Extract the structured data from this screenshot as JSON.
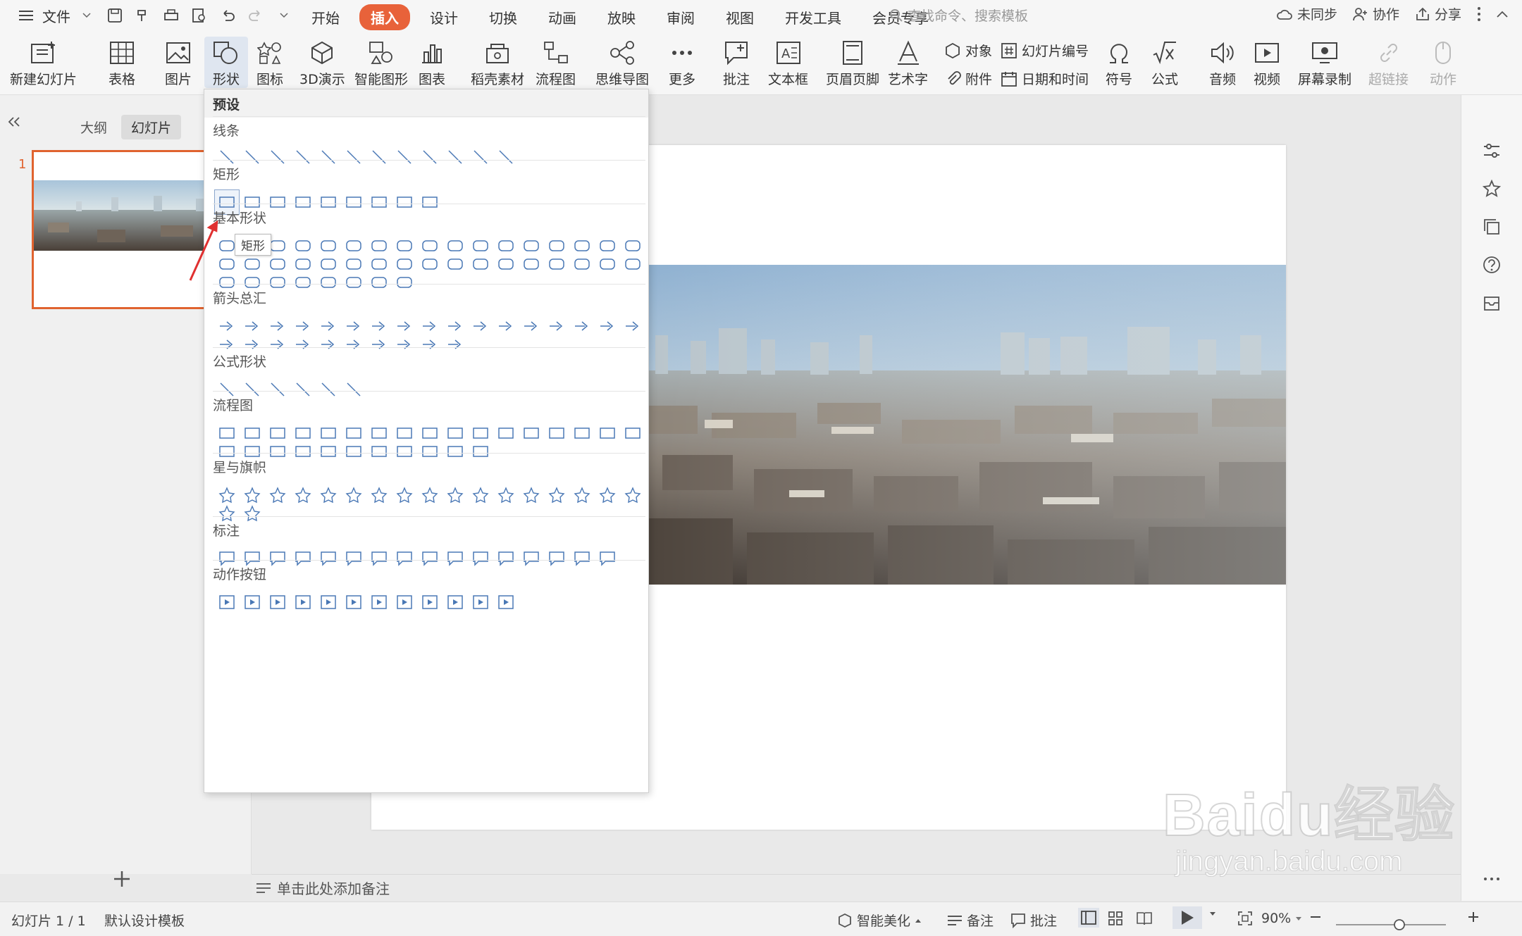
{
  "menubar": {
    "file_label": "文件",
    "tabs": [
      "开始",
      "插入",
      "设计",
      "切换",
      "动画",
      "放映",
      "审阅",
      "视图",
      "开发工具",
      "会员专享"
    ],
    "active_tab_index": 1,
    "search_placeholder": "查找命令、搜索模板",
    "sync_label": "未同步",
    "collab_label": "协作",
    "share_label": "分享"
  },
  "ribbon": {
    "new_slide": "新建幻灯片",
    "table": "表格",
    "picture": "图片",
    "shape": "形状",
    "icon": "图标",
    "demo3d": "3D演示",
    "smartart": "智能图形",
    "chart": "图表",
    "material": "稻壳素材",
    "flowchart": "流程图",
    "mindmap": "思维导图",
    "more": "更多",
    "comment": "批注",
    "textbox": "文本框",
    "header_footer": "页眉页脚",
    "wordart": "艺术字",
    "object": "对象",
    "attachment": "附件",
    "slide_number": "幻灯片编号",
    "datetime": "日期和时间",
    "symbol": "符号",
    "formula": "公式",
    "audio": "音频",
    "video": "视频",
    "screen_record": "屏幕录制",
    "hyperlink": "超链接",
    "action": "动作"
  },
  "left_panel": {
    "outline_tab": "大纲",
    "slides_tab": "幻灯片",
    "slide_number": "1"
  },
  "notes_placeholder": "单击此处添加备注",
  "status": {
    "slide_info": "幻灯片 1 / 1",
    "template": "默认设计模板",
    "beautify": "智能美化",
    "notes": "备注",
    "comments": "批注",
    "zoom": "90%"
  },
  "shapes_panel": {
    "header": "预设",
    "categories": [
      {
        "title": "线条",
        "count": 12
      },
      {
        "title": "矩形",
        "count": 9
      },
      {
        "title": "基本形状",
        "count": 42
      },
      {
        "title": "箭头总汇",
        "count": 27
      },
      {
        "title": "公式形状",
        "count": 6
      },
      {
        "title": "流程图",
        "count": 28
      },
      {
        "title": "星与旗帜",
        "count": 19
      },
      {
        "title": "标注",
        "count": 16
      },
      {
        "title": "动作按钮",
        "count": 12
      }
    ],
    "tooltip": "矩形"
  },
  "watermark": {
    "brand": "Baidu经验",
    "url": "jingyan.baidu.com"
  },
  "colors": {
    "accent": "#e8623a",
    "selection_border": "#e0632f",
    "shape_stroke": "#4a78b5"
  }
}
